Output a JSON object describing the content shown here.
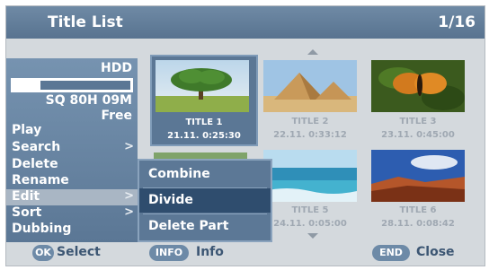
{
  "header": {
    "title": "Title List",
    "page": "1/16"
  },
  "disk": {
    "label": "HDD",
    "size": "SQ 80H 09M",
    "free": "Free",
    "used_fraction": 0.25
  },
  "menu": {
    "items": [
      {
        "label": "Play",
        "chevron": ""
      },
      {
        "label": "Search",
        "chevron": ">"
      },
      {
        "label": "Delete",
        "chevron": ""
      },
      {
        "label": "Rename",
        "chevron": ""
      },
      {
        "label": "Edit",
        "chevron": ">"
      },
      {
        "label": "Sort",
        "chevron": ">"
      },
      {
        "label": "Dubbing",
        "chevron": ""
      }
    ],
    "selected_index": 4
  },
  "submenu": {
    "items": [
      {
        "label": "Combine"
      },
      {
        "label": "Divide"
      },
      {
        "label": "Delete Part"
      }
    ],
    "selected_index": 1
  },
  "titles": [
    {
      "title": "TITLE 1",
      "date": "21.11.",
      "duration": "0:25:30",
      "thumb": "tree-icon"
    },
    {
      "title": "TITLE 2",
      "date": "22.11.",
      "duration": "0:33:12",
      "thumb": "pyramid-icon"
    },
    {
      "title": "TITLE 3",
      "date": "23.11.",
      "duration": "0:45:00",
      "thumb": "butterfly-icon"
    },
    {
      "title": "TITLE 5",
      "date": "24.11.",
      "duration": "0:05:00",
      "thumb": "sea-icon"
    },
    {
      "title": "TITLE 6",
      "date": "28.11.",
      "duration": "0:08:42",
      "thumb": "landscape-icon"
    }
  ],
  "footer": {
    "ok_key": "OK",
    "ok_label": "Select",
    "info_key": "INFO",
    "info_label": "Info",
    "end_key": "END",
    "end_label": "Close"
  },
  "colors": {
    "accent": "#5b7795",
    "selected": "#2f4d6e",
    "background": "#d4d9dd"
  }
}
